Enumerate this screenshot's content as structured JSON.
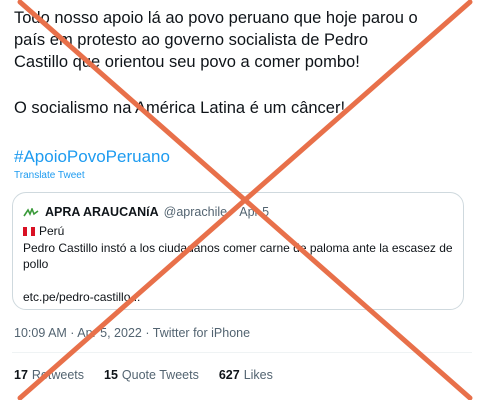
{
  "tweet": {
    "text_lines": [
      "Todo nosso apoio lá ao povo peruano que hoje parou o",
      "país em protesto ao governo socialista de Pedro",
      "Castillo que orientou seu povo a comer pombo!"
    ],
    "text_para2": "O socialismo na América Latina é um câncer!",
    "hashtag": "#ApoioPovoPeruano",
    "translate_label": "Translate Tweet",
    "timestamp": "10:09 AM · Apr 5, 2022",
    "meta_sep": "·",
    "source": "Twitter for iPhone"
  },
  "quote": {
    "author_name": "APRA ARAUCANíA",
    "author_handle": "@aprachile",
    "sep": "·",
    "date": "Apr 5",
    "country": "Perú",
    "body": "Pedro Castillo instó a los ciudadanos comer carne de paloma ante la escasez de pollo",
    "link": "etc.pe/pedro-castillo..."
  },
  "stats": {
    "retweets_count": "17",
    "retweets_label": "Retweets",
    "quotes_count": "15",
    "quotes_label": "Quote Tweets",
    "likes_count": "627",
    "likes_label": "Likes"
  },
  "colors": {
    "link": "#1d9bf0",
    "secondary_text": "#536471",
    "border": "#cfd9de",
    "false_mark": "#e8704a"
  },
  "icons": [
    "apra-logo-icon",
    "peru-flag-icon",
    "false-x-mark-icon"
  ]
}
